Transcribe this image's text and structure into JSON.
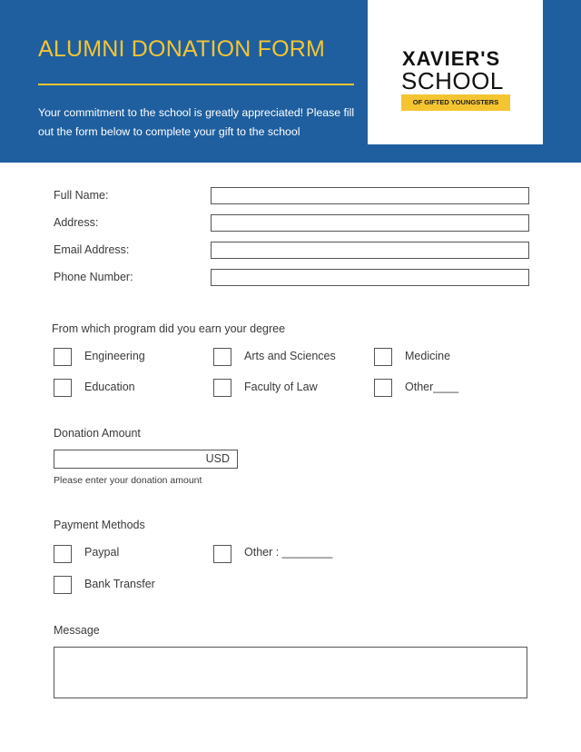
{
  "header": {
    "title": "ALUMNI DONATION FORM",
    "subtitle": "Your commitment to the school is greatly appreciated! Please fill out the form below to complete your gift to the school",
    "colors": {
      "background": "#1f5f9f",
      "accent": "#f5c531"
    }
  },
  "logo": {
    "line1": "XAVIER'S",
    "line2": "SCHOOL",
    "tagline": "OF GIFTED YOUNGSTERS"
  },
  "contact_fields": [
    {
      "label": "Full Name:",
      "value": ""
    },
    {
      "label": "Address:",
      "value": ""
    },
    {
      "label": "Email Address:",
      "value": ""
    },
    {
      "label": "Phone Number:",
      "value": ""
    }
  ],
  "program": {
    "question": "From which program did you earn your degree",
    "options": [
      "Engineering",
      "Arts and Sciences",
      "Medicine",
      "Education",
      "Faculty of Law",
      "Other____"
    ]
  },
  "donation": {
    "label": "Donation Amount",
    "value": "",
    "currency": "USD",
    "hint": "Please enter your donation amount"
  },
  "payment": {
    "label": "Payment Methods",
    "options": [
      "Paypal",
      "Other : ________",
      "Bank Transfer"
    ]
  },
  "message": {
    "label": "Message",
    "value": ""
  }
}
